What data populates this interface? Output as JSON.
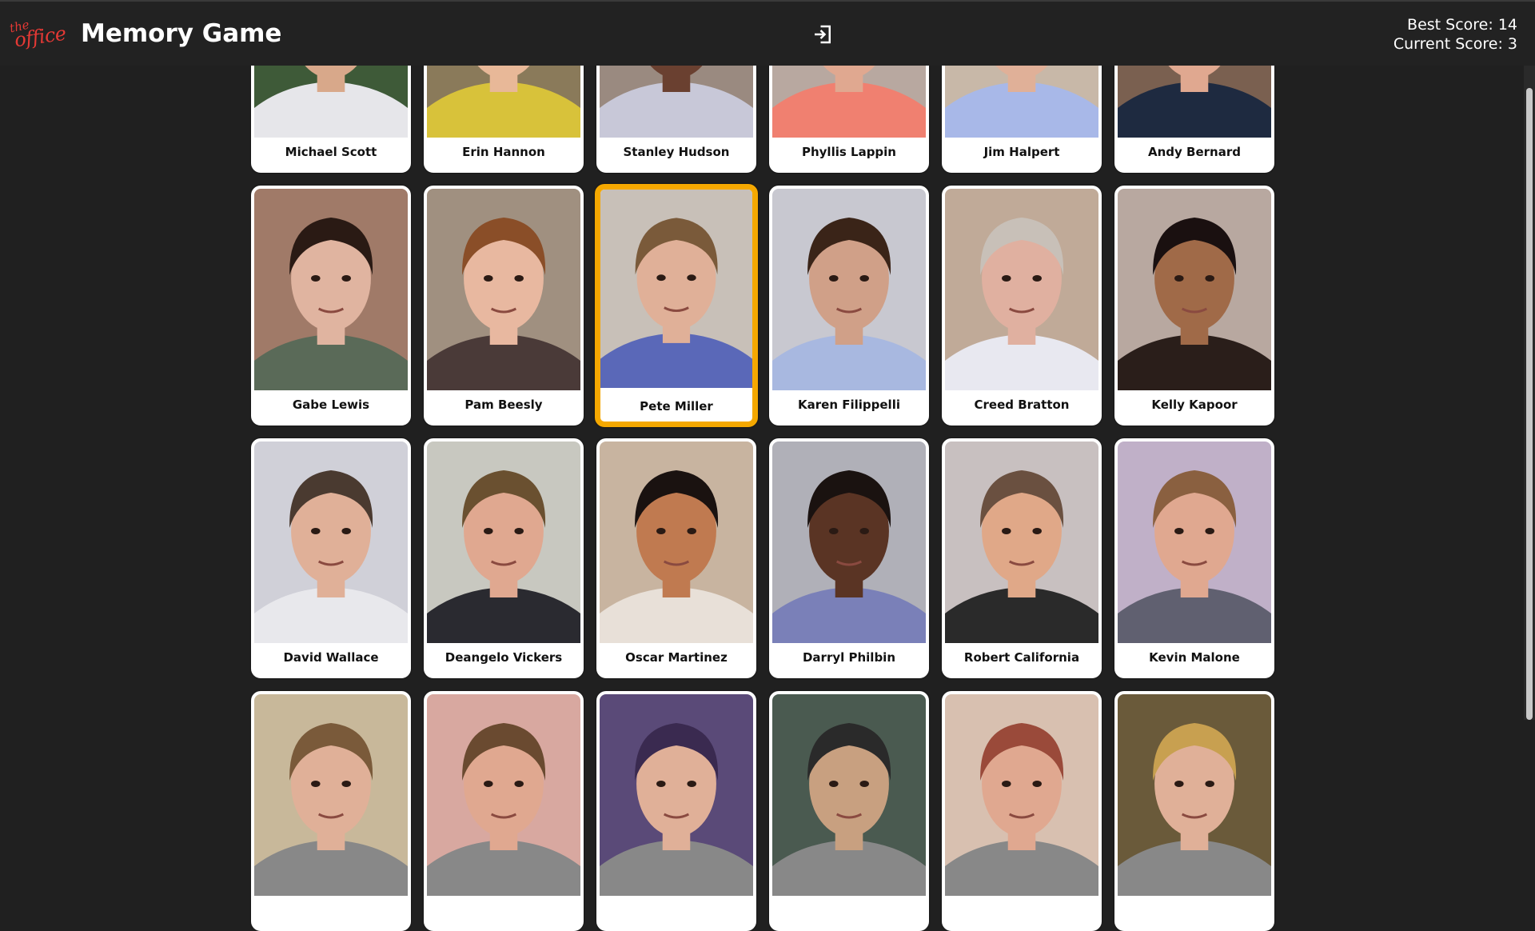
{
  "header": {
    "logo_the": "the",
    "logo_office": "office",
    "title": "Memory Game",
    "exit_icon": "sign-in-arrow-icon",
    "best_score_label": "Best Score: 14",
    "current_score_label": "Current Score: 3"
  },
  "colors": {
    "background": "#202020",
    "header": "#222222",
    "logo_red": "#e53935",
    "selected_border": "#f5a800"
  },
  "cards": [
    {
      "name": "Michael Scott",
      "skin": "#d8a88a",
      "hair": "#5a3a24",
      "bg": "#3e5a38",
      "shirt": "#e6e6ea",
      "selected": false
    },
    {
      "name": "Erin Hannon",
      "skin": "#e8b898",
      "hair": "#b07a3e",
      "bg": "#8a7a5a",
      "shirt": "#d8c23a",
      "selected": false
    },
    {
      "name": "Stanley Hudson",
      "skin": "#6a4030",
      "hair": "#2a1a14",
      "bg": "#9a8a80",
      "shirt": "#c8c8d8",
      "selected": false
    },
    {
      "name": "Phyllis Lappin",
      "skin": "#e0a890",
      "hair": "#8a6a5a",
      "bg": "#b8a8a0",
      "shirt": "#f08070",
      "selected": false
    },
    {
      "name": "Jim Halpert",
      "skin": "#e0b098",
      "hair": "#5a3a24",
      "bg": "#c8b8a8",
      "shirt": "#a8b8e8",
      "selected": false
    },
    {
      "name": "Andy Bernard",
      "skin": "#e0a890",
      "hair": "#6a4a30",
      "bg": "#7a6050",
      "shirt": "#1e2a40",
      "selected": false
    },
    {
      "name": "Gabe Lewis",
      "skin": "#e0b4a0",
      "hair": "#2a1a14",
      "bg": "#a07a68",
      "shirt": "#5a6a58",
      "selected": false
    },
    {
      "name": "Pam Beesly",
      "skin": "#e8b8a0",
      "hair": "#8a4e28",
      "bg": "#a09080",
      "shirt": "#4a3a38",
      "selected": false
    },
    {
      "name": "Pete Miller",
      "skin": "#e0b098",
      "hair": "#7a5a3a",
      "bg": "#c8c0b8",
      "shirt": "#5a68b8",
      "selected": true
    },
    {
      "name": "Karen Filippelli",
      "skin": "#d0a088",
      "hair": "#3a2418",
      "bg": "#c8c8d0",
      "shirt": "#a8b8e0",
      "selected": false
    },
    {
      "name": "Creed Bratton",
      "skin": "#e0b0a0",
      "hair": "#c8c0b8",
      "bg": "#c0aa98",
      "shirt": "#e8e8f0",
      "selected": false
    },
    {
      "name": "Kelly Kapoor",
      "skin": "#a06a48",
      "hair": "#1a1010",
      "bg": "#b8a8a0",
      "shirt": "#2a1e1a",
      "selected": false
    },
    {
      "name": "David Wallace",
      "skin": "#e0b098",
      "hair": "#4a3a30",
      "bg": "#d0d0d8",
      "shirt": "#e8e8ec",
      "selected": false
    },
    {
      "name": "Deangelo Vickers",
      "skin": "#e0a890",
      "hair": "#6a5030",
      "bg": "#c8c8c0",
      "shirt": "#2a2a30",
      "selected": false
    },
    {
      "name": "Oscar Martinez",
      "skin": "#c07a50",
      "hair": "#1a1210",
      "bg": "#c8b4a0",
      "shirt": "#e8e0d8",
      "selected": false
    },
    {
      "name": "Darryl Philbin",
      "skin": "#5a3424",
      "hair": "#1a1210",
      "bg": "#b0b0b8",
      "shirt": "#7a80b8",
      "selected": false
    },
    {
      "name": "Robert California",
      "skin": "#e0a888",
      "hair": "#6a5040",
      "bg": "#c8c0c0",
      "shirt": "#2a2a2a",
      "selected": false
    },
    {
      "name": "Kevin Malone",
      "skin": "#e0a890",
      "hair": "#8a6040",
      "bg": "#c0b0c8",
      "shirt": "#606070",
      "selected": false
    },
    {
      "name": "",
      "skin": "#e0b098",
      "hair": "#7a5a3a",
      "bg": "#c8b89a",
      "shirt": "#888",
      "selected": false
    },
    {
      "name": "",
      "skin": "#e0a890",
      "hair": "#6a4a30",
      "bg": "#d8a8a0",
      "shirt": "#888",
      "selected": false
    },
    {
      "name": "",
      "skin": "#e0b098",
      "hair": "#3a2a50",
      "bg": "#5a4a78",
      "shirt": "#888",
      "selected": false
    },
    {
      "name": "",
      "skin": "#c8a080",
      "hair": "#2a2a2a",
      "bg": "#4a5a50",
      "shirt": "#888",
      "selected": false
    },
    {
      "name": "",
      "skin": "#e0a890",
      "hair": "#9a4a3a",
      "bg": "#d8c0b0",
      "shirt": "#888",
      "selected": false
    },
    {
      "name": "",
      "skin": "#e0b098",
      "hair": "#c8a050",
      "bg": "#6a5a3a",
      "shirt": "#888",
      "selected": false
    }
  ]
}
